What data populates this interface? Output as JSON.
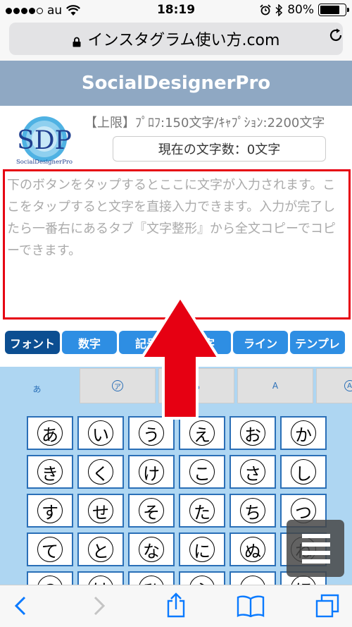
{
  "status": {
    "carrier": "au",
    "time": "18:19",
    "battery": "80%",
    "battery_level": 0.8
  },
  "browser": {
    "url": "インスタグラム使い方.com"
  },
  "site": {
    "title": "SocialDesignerPro",
    "logo_text": "SDP",
    "logo_sub": "SocialDesignerPro",
    "limit_text": "【上限】ﾌﾟﾛﾌ:150文字/ｷｬﾌﾟｼｮﾝ:2200文字",
    "count_text": "現在の文字数：0文字",
    "placeholder": "下のボタンをタップするとここに文字が入力されます。ここをタップすると文字を直接入力できます。入力が完了したら一番右にあるタブ『文字整形』から全文コピーでコピーできます。"
  },
  "tabs": [
    {
      "label": "フォント"
    },
    {
      "label": "数字"
    },
    {
      "label": "記号"
    },
    {
      "label": "文字"
    },
    {
      "label": "ライン"
    },
    {
      "label": "テンプレ"
    }
  ],
  "keyboard": {
    "tabs": [
      {
        "label": "あ"
      },
      {
        "label": "ア"
      },
      {
        "label": "ら"
      },
      {
        "label": "A"
      },
      {
        "label": "A"
      }
    ],
    "rows": [
      [
        "あ",
        "い",
        "う",
        "え",
        "お",
        "か"
      ],
      [
        "き",
        "く",
        "け",
        "こ",
        "さ",
        "し"
      ],
      [
        "す",
        "せ",
        "そ",
        "た",
        "ち",
        "つ"
      ],
      [
        "て",
        "と",
        "な",
        "に",
        "ぬ",
        "ね"
      ],
      [
        "の",
        "は",
        "ひ",
        "ふ",
        "へ",
        "ほ"
      ]
    ]
  },
  "colors": {
    "header": "#8fa8c3",
    "tab": "#2e8ee3",
    "tab_active": "#0c4e91",
    "highlight": "#e60012"
  },
  "icons": {
    "back": "back-chevron-icon",
    "forward": "forward-chevron-icon",
    "share": "share-icon",
    "bookmarks": "bookmarks-icon",
    "tabs": "tabs-icon",
    "menu": "hamburger-menu-icon"
  }
}
